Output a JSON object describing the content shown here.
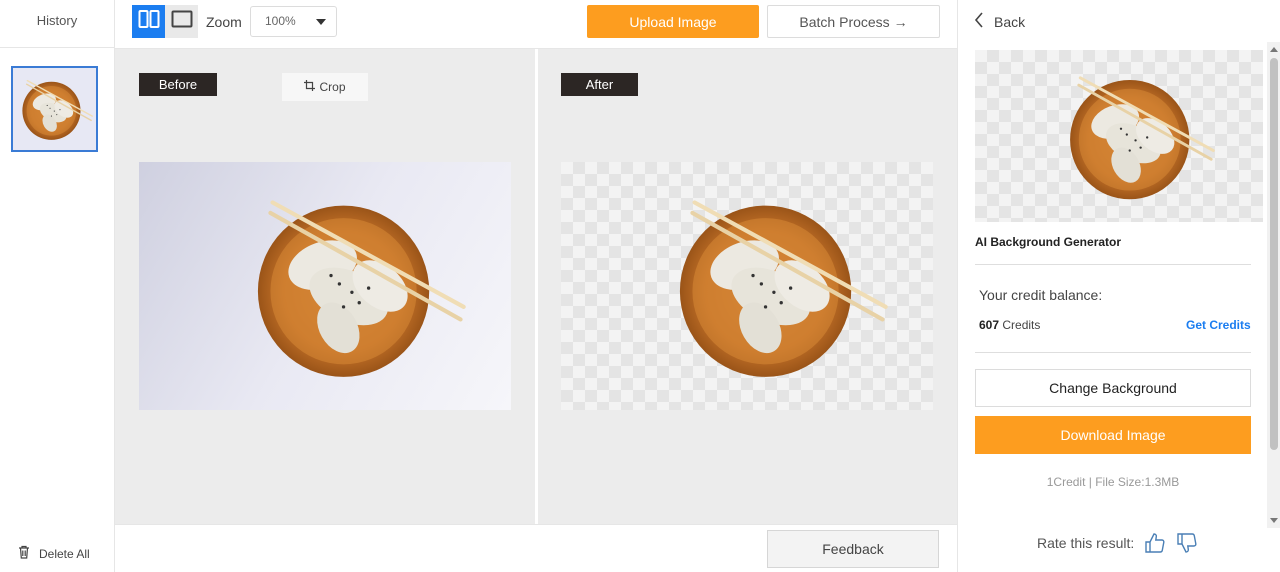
{
  "history": {
    "title": "History",
    "delete_all_label": "Delete All"
  },
  "toolbar": {
    "zoom_label": "Zoom",
    "zoom_value": "100%",
    "upload_label": "Upload Image",
    "batch_label": "Batch Process →"
  },
  "before_pane": {
    "tag": "Before",
    "crop_label": "Crop"
  },
  "after_pane": {
    "tag": "After"
  },
  "footer": {
    "feedback_label": "Feedback"
  },
  "right_panel": {
    "back_label": "Back",
    "tool_name": "AI Background Generator",
    "credit_label": "Your credit balance:",
    "credit_amount": "607",
    "credit_unit": "Credits",
    "get_credits_label": "Get Credits",
    "change_bg_label": "Change Background",
    "download_label": "Download Image",
    "meta": "1Credit | File Size:1.3MB",
    "rate_label": "Rate this result:"
  },
  "colors": {
    "accent_orange": "#fd9d1f",
    "accent_blue": "#1b7df0",
    "tag_bg": "#2c2624"
  },
  "icons": [
    "split-view-icon",
    "single-view-icon",
    "caret-down-icon",
    "trash-icon",
    "crop-icon",
    "chevron-left-icon",
    "thumbs-up-icon",
    "thumbs-down-icon"
  ]
}
